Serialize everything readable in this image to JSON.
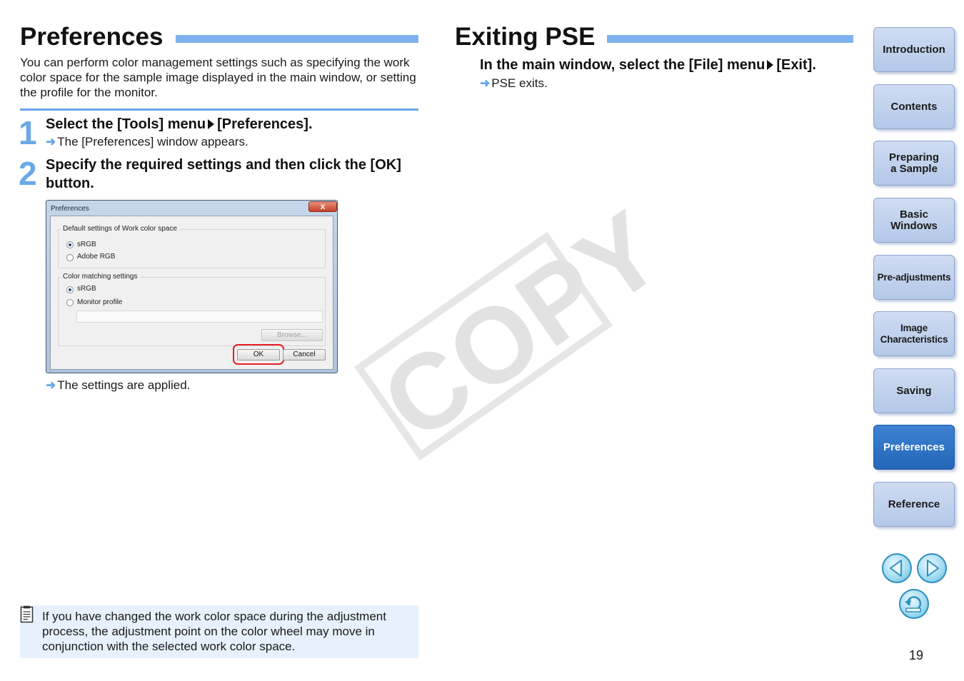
{
  "left": {
    "title": "Preferences",
    "intro": "You can perform color management settings such as specifying the work color space for the sample image displayed in the main window, or setting the profile for the monitor.",
    "steps": [
      {
        "num": "1",
        "title_a": "Select the [Tools] menu",
        "title_b": "[Preferences].",
        "result": "The [Preferences] window appears."
      },
      {
        "num": "2",
        "title": "Specify the required settings and then click the [OK] button."
      }
    ],
    "after_result": "The settings are applied.",
    "note": "If you have changed the work color space during the adjustment process, the adjustment point on the color wheel may move in conjunction with the selected work color space."
  },
  "dialog": {
    "title": "Preferences",
    "close": "x",
    "group1_label": "Default settings of Work color space",
    "group1_options": [
      "sRGB",
      "Adobe RGB"
    ],
    "group2_label": "Color matching settings",
    "group2_options": [
      "sRGB",
      "Monitor profile"
    ],
    "browse": "Browse...",
    "ok": "OK",
    "cancel": "Cancel"
  },
  "right": {
    "title": "Exiting PSE",
    "step_a": "In the main window, select the [File] menu",
    "step_b": "[Exit].",
    "result": "PSE exits."
  },
  "watermark": "COPY",
  "sidebar": {
    "tabs": [
      {
        "label": "Introduction"
      },
      {
        "label": "Contents"
      },
      {
        "label": "Preparing\na Sample"
      },
      {
        "label": "Basic\nWindows"
      },
      {
        "label": "Pre-adjustments"
      },
      {
        "label": "Image\nCharacteristics"
      },
      {
        "label": "Saving"
      },
      {
        "label": "Preferences"
      },
      {
        "label": "Reference"
      }
    ],
    "active_tab": "Preferences"
  },
  "page_number": "19",
  "colors": {
    "accent": "#7fb2ec",
    "active_tab": "#2466b8",
    "ok_highlight": "#e41e26",
    "note_bg": "#e6f1fd"
  }
}
